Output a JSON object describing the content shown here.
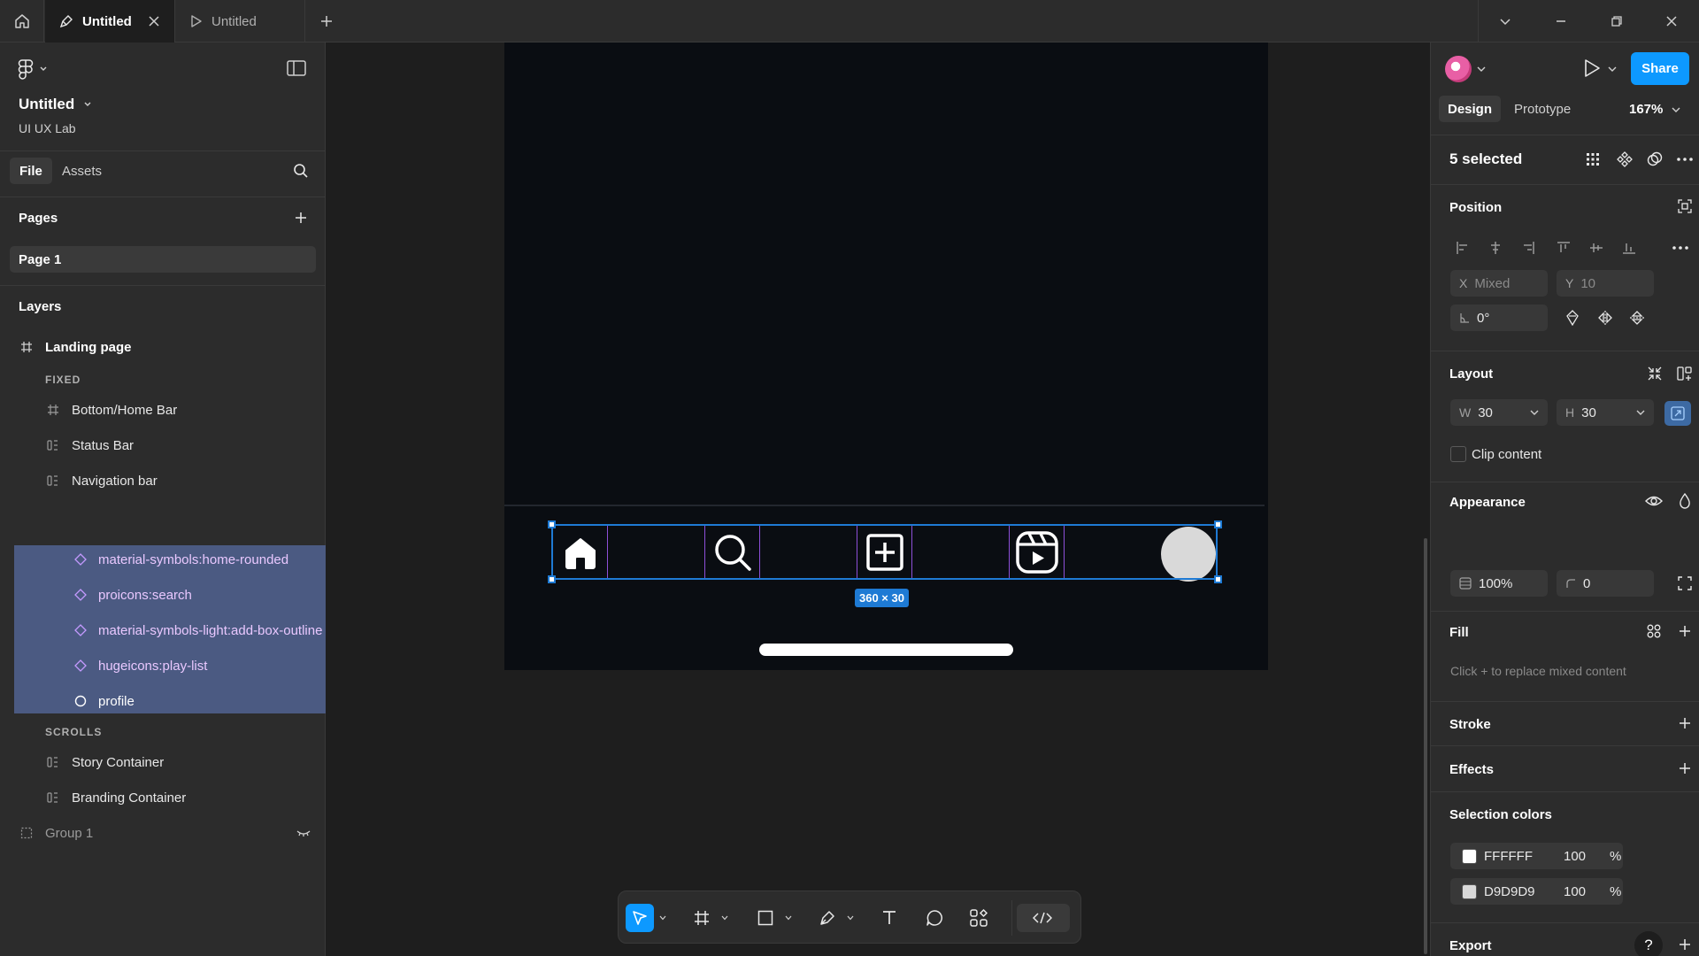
{
  "topbar": {
    "tabs": [
      {
        "label": "Untitled",
        "icon": "pen-icon",
        "active": true
      },
      {
        "label": "Untitled",
        "icon": "play-outline-icon",
        "active": false
      }
    ]
  },
  "left_panel": {
    "file_name": "Untitled",
    "team_name": "UI UX Lab",
    "tabs": [
      "File",
      "Assets"
    ],
    "pages_title": "Pages",
    "pages": [
      "Page 1"
    ],
    "layers_title": "Layers",
    "layers": {
      "frame": "Landing page",
      "fixed_label": "FIXED",
      "fixed_items": [
        "Bottom/Home Bar",
        "Status Bar",
        "Navigation bar"
      ],
      "selected_items": [
        "material-symbols:home-rounded",
        "proicons:search",
        "material-symbols-light:add-box-outline",
        "hugeicons:play-list",
        "profile"
      ],
      "scrolls_label": "SCROLLS",
      "scroll_items": [
        "Story Container",
        "Branding Container"
      ],
      "group": "Group 1"
    }
  },
  "canvas": {
    "size_badge": "360 × 30"
  },
  "right_panel": {
    "share_label": "Share",
    "tabs": [
      "Design",
      "Prototype"
    ],
    "zoom": "167%",
    "selection_count": "5 selected",
    "position": {
      "title": "Position",
      "x_label": "X",
      "x_value": "Mixed",
      "y_label": "Y",
      "y_value": "10",
      "rotation": "0°"
    },
    "layout": {
      "title": "Layout",
      "w_label": "W",
      "w_value": "30",
      "h_label": "H",
      "h_value": "30",
      "clip_label": "Clip content"
    },
    "appearance": {
      "title": "Appearance",
      "opacity": "100%",
      "radius": "0"
    },
    "fill": {
      "title": "Fill",
      "hint": "Click + to replace mixed content"
    },
    "stroke_title": "Stroke",
    "effects_title": "Effects",
    "selection_colors": {
      "title": "Selection colors",
      "colors": [
        {
          "hex": "FFFFFF",
          "swatch": "#ffffff",
          "opacity": "100",
          "unit": "%"
        },
        {
          "hex": "D9D9D9",
          "swatch": "#d9d9d9",
          "opacity": "100",
          "unit": "%"
        }
      ]
    },
    "export_title": "Export",
    "help": "?"
  }
}
